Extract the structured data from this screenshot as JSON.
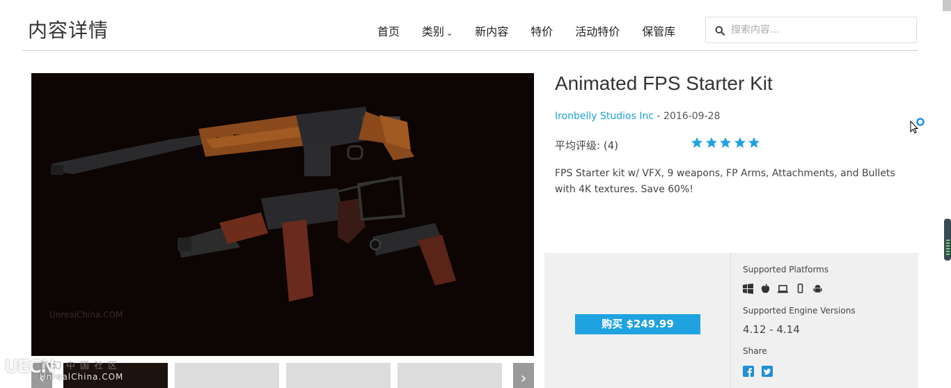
{
  "header": {
    "site_title": "内容详情",
    "nav": [
      {
        "label": "首页"
      },
      {
        "label": "类别",
        "has_dropdown": true
      },
      {
        "label": "新内容"
      },
      {
        "label": "特价"
      },
      {
        "label": "活动特价"
      },
      {
        "label": "保管库"
      }
    ],
    "search": {
      "placeholder": "搜索内容..."
    }
  },
  "gallery": {
    "image_watermark": "UnrealChina.COM",
    "thumbnail_count": 5
  },
  "watermark_logo": {
    "mark": "UECN",
    "chinese": "虚幻中国社区",
    "english": "UnrealChina.COM"
  },
  "product": {
    "title": "Animated FPS Starter Kit",
    "publisher": "Ironbelly Studios Inc",
    "date_sep": " - ",
    "date": "2016-09-28",
    "rating_label": "平均评级:",
    "rating_count": "(4)",
    "rating_value": 5,
    "rating_max": 5,
    "description": "FPS Starter kit w/ VFX, 9 weapons, FP Arms, Attachments, and Bullets with 4K textures. Save 60%!"
  },
  "purchase": {
    "buy_label": "购买 $249.99",
    "platforms_label": "Supported Platforms",
    "platform_icons": [
      "windows-icon",
      "apple-icon",
      "laptop-icon",
      "mobile-icon",
      "android-icon"
    ],
    "engine_versions_label": "Supported Engine Versions",
    "engine_versions": "4.12 - 4.14",
    "share_label": "Share",
    "share_icons": [
      "facebook-icon",
      "twitter-icon"
    ]
  },
  "colors": {
    "accent": "#1fa3e0",
    "panel_bg": "#f0f0f0",
    "image_bg": "#0d0404"
  }
}
